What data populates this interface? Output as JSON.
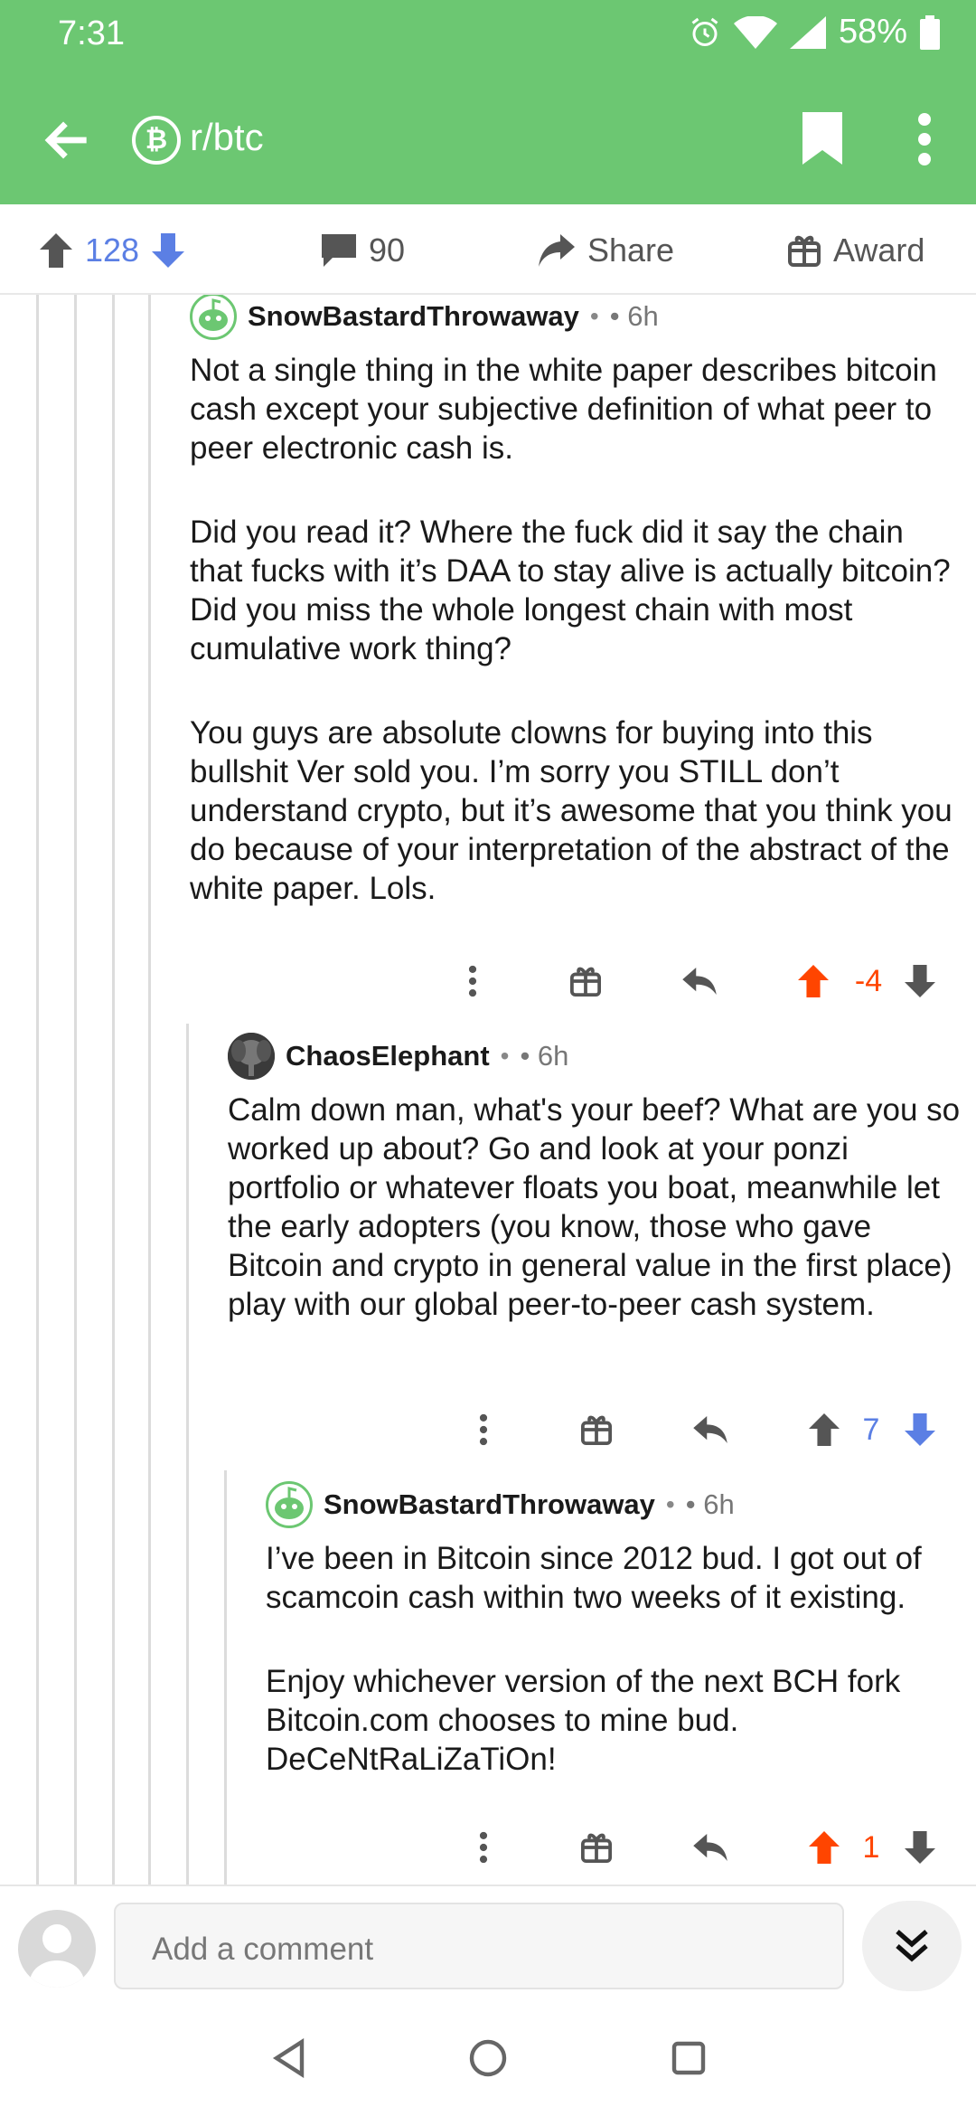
{
  "status": {
    "time": "7:31",
    "battery": "58%"
  },
  "appbar": {
    "subreddit": "r/btc",
    "sub_icon_glyph": "₿"
  },
  "post_actions": {
    "upvotes": "128",
    "comments": "90",
    "share": "Share",
    "award": "Award"
  },
  "comments": [
    {
      "author": "SnowBastardThrowaway",
      "dot": "•",
      "age": "• 6h",
      "paragraphs": [
        "Not a single thing in the white paper describes bitcoin cash except your subjective definition of what peer to peer electronic cash is.",
        "Did you read it? Where the fuck did it say the chain that fucks with it’s DAA to stay alive is actually bitcoin? Did you miss the whole longest chain with most cumulative work thing?",
        "You guys are absolute clowns for buying into this bullshit Ver sold you. I’m sorry you STILL don’t understand crypto, but it’s awesome that you think you do because of your interpretation of the abstract of the white paper. Lols."
      ],
      "score": "-4",
      "vote_state": "upvoted"
    },
    {
      "author": "ChaosElephant",
      "dot": "•",
      "age": "• 6h",
      "paragraphs": [
        "Calm down man, what's your beef? What are you so worked up about? Go and look at your ponzi portfolio or whatever floats you boat, meanwhile let the early adopters (you know, those who gave Bitcoin and crypto in general value in the first place) play with our global peer-to-peer cash system."
      ],
      "score": "7",
      "vote_state": "downvoted"
    },
    {
      "author": "SnowBastardThrowaway",
      "dot": "•",
      "age": "• 6h",
      "paragraphs": [
        "I’ve been in Bitcoin since 2012 bud. I got out of scamcoin cash within two weeks of it existing.",
        "Enjoy whichever version of the next BCH fork Bitcoin.com chooses to mine bud. DeCeNtRaLiZaTiOn!"
      ],
      "score": "1",
      "vote_state": "upvoted"
    }
  ],
  "composer": {
    "placeholder": "Add a comment"
  },
  "colors": {
    "brand_green": "#6cc772",
    "upvote": "#ff4500",
    "downvote": "#5b7fe4",
    "icon_grey": "#555555"
  }
}
